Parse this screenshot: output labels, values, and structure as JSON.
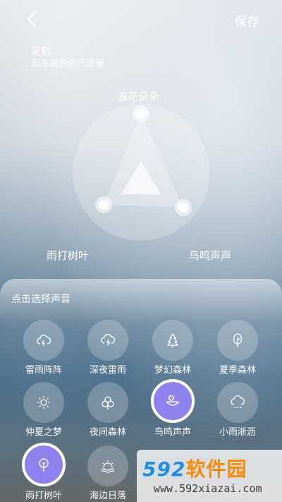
{
  "header": {
    "save_label": "保存"
  },
  "title": {
    "line1": "定制",
    "line2": "您专属的音乐场景"
  },
  "mixer": {
    "top_label": "浪花朵朵",
    "left_label": "雨打树叶",
    "right_label": "鸟鸣声声"
  },
  "panel": {
    "title": "点击选择声音",
    "sounds": [
      {
        "label": "雷雨阵阵",
        "icon": "storm-cloud-icon",
        "active": false
      },
      {
        "label": "深夜雷雨",
        "icon": "night-storm-icon",
        "active": false
      },
      {
        "label": "梦幻森林",
        "icon": "pine-tree-icon",
        "active": false
      },
      {
        "label": "夏季森林",
        "icon": "tree-icon",
        "active": false
      },
      {
        "label": "仲夏之梦",
        "icon": "sun-icon",
        "active": false
      },
      {
        "label": "夜间森林",
        "icon": "bushes-icon",
        "active": false
      },
      {
        "label": "鸟鸣声声",
        "icon": "bird-nest-icon",
        "active": true
      },
      {
        "label": "小雨淅沥",
        "icon": "rain-cloud-icon",
        "active": false
      },
      {
        "label": "雨打树叶",
        "icon": "leaf-drop-icon",
        "active": true
      },
      {
        "label": "海边日落",
        "icon": "sunset-icon",
        "active": false
      }
    ]
  },
  "watermark": {
    "brand_num": "592",
    "brand_cn": "软件园",
    "url": "www.592xiazai.com"
  },
  "colors": {
    "active_accent": "#8e82ee",
    "watermark_blue": "#1f8fe5",
    "watermark_orange": "#ff8a00"
  }
}
